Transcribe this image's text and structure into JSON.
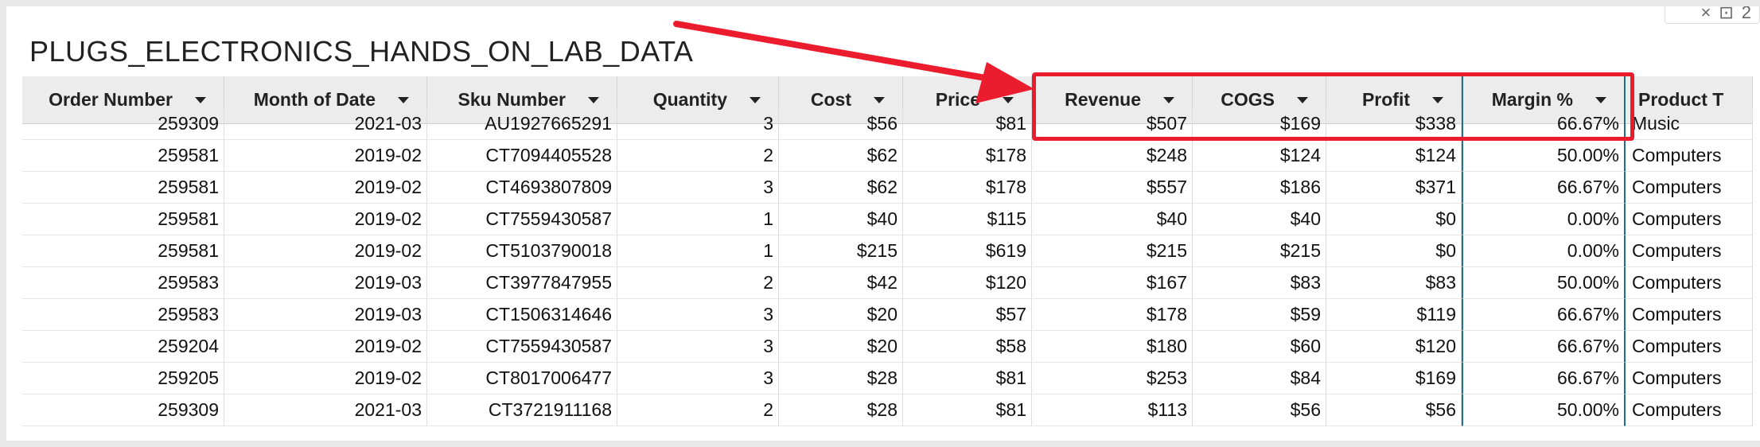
{
  "title": "PLUGS_ELECTRONICS_HANDS_ON_LAB_DATA",
  "corner": {
    "icons": [
      "×",
      "⊡",
      "2"
    ]
  },
  "columns": [
    "Order Number",
    "Month of Date",
    "Sku Number",
    "Quantity",
    "Cost",
    "Price",
    "Revenue",
    "COGS",
    "Profit",
    "Margin %",
    "Product T"
  ],
  "rows": [
    [
      "259309",
      "2021-03",
      "AU1927665291",
      "3",
      "$56",
      "$81",
      "$507",
      "$169",
      "$338",
      "66.67%",
      "Music"
    ],
    [
      "259581",
      "2019-02",
      "CT7094405528",
      "2",
      "$62",
      "$178",
      "$248",
      "$124",
      "$124",
      "50.00%",
      "Computers"
    ],
    [
      "259581",
      "2019-02",
      "CT4693807809",
      "3",
      "$62",
      "$178",
      "$557",
      "$186",
      "$371",
      "66.67%",
      "Computers"
    ],
    [
      "259581",
      "2019-02",
      "CT7559430587",
      "1",
      "$40",
      "$115",
      "$40",
      "$40",
      "$0",
      "0.00%",
      "Computers"
    ],
    [
      "259581",
      "2019-02",
      "CT5103790018",
      "1",
      "$215",
      "$619",
      "$215",
      "$215",
      "$0",
      "0.00%",
      "Computers"
    ],
    [
      "259583",
      "2019-03",
      "CT3977847955",
      "2",
      "$42",
      "$120",
      "$167",
      "$83",
      "$83",
      "50.00%",
      "Computers"
    ],
    [
      "259583",
      "2019-03",
      "CT1506314646",
      "3",
      "$20",
      "$57",
      "$178",
      "$59",
      "$119",
      "66.67%",
      "Computers"
    ],
    [
      "259204",
      "2019-02",
      "CT7559430587",
      "3",
      "$20",
      "$58",
      "$180",
      "$60",
      "$120",
      "66.67%",
      "Computers"
    ],
    [
      "259205",
      "2019-02",
      "CT8017006477",
      "3",
      "$28",
      "$81",
      "$253",
      "$84",
      "$169",
      "66.67%",
      "Computers"
    ],
    [
      "259309",
      "2021-03",
      "CT3721911168",
      "2",
      "$28",
      "$81",
      "$113",
      "$56",
      "$56",
      "50.00%",
      "Computers"
    ]
  ],
  "colors": {
    "highlight": "#ec1c2f",
    "selected_column": "#1f6f94",
    "header_bg": "#ececec"
  }
}
